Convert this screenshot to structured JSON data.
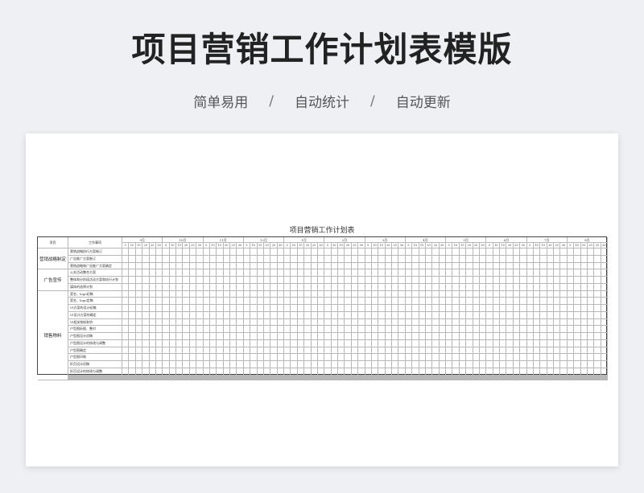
{
  "hero": {
    "title": "项目营销工作计划表模版",
    "features": [
      "简单易用",
      "自动统计",
      "自动更新"
    ],
    "separator": "/"
  },
  "sheet": {
    "title": "项目营销工作计划表",
    "header": {
      "project": "项目",
      "task": "工作事项"
    },
    "months": [
      "9月",
      "10月",
      "11月",
      "12月",
      "1月",
      "2月",
      "3月",
      "4月",
      "5月",
      "6月",
      "7月",
      "8月"
    ],
    "days": [
      "5",
      "10",
      "15",
      "20",
      "25",
      "30"
    ],
    "categories": [
      {
        "name": "营销战略制定",
        "tasks": [
          "营销战略执行方案制订",
          "广告推广方案制订",
          "营销战略和广告推广方案确定"
        ]
      },
      {
        "name": "广告宣传",
        "tasks": [
          "公关活动整合方案",
          "整体和分阶段活动方案和执行计划",
          "媒体的选择计划"
        ]
      },
      {
        "name": "销售物料",
        "tasks": [
          "案名、logo初稿",
          "案名、logo定稿",
          "VI方案的设计初稿",
          "VI设计方案的确定",
          "VI相关物料制作",
          "户型图拆图、整对",
          "户型图设计初稿",
          "户型图设计的修改与调整",
          "户型图确定",
          "户型图印制",
          "折页设计初稿",
          "折页设计的修改与调整",
          "折页确定",
          "折页制作",
          "户外广告设计初稿",
          "户外广告设计的修改与调整",
          "户外广告确定",
          "户外广告位置选定与投放"
        ]
      }
    ]
  }
}
